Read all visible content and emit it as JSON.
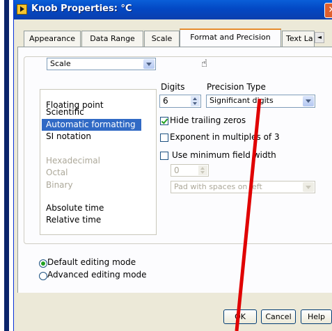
{
  "window": {
    "title": "Knob Properties: °C"
  },
  "tabs": [
    {
      "label": "Appearance"
    },
    {
      "label": "Data Range"
    },
    {
      "label": "Scale"
    },
    {
      "label": "Format and Precision",
      "active": true
    },
    {
      "label": "Text La"
    }
  ],
  "format": {
    "item_combo": {
      "value": "Scale"
    },
    "type_list": {
      "items": [
        {
          "label": "Floating point",
          "state": "normal"
        },
        {
          "label": "Scientific",
          "state": "normal"
        },
        {
          "label": "Automatic formatting",
          "state": "selected"
        },
        {
          "label": "SI notation",
          "state": "normal"
        },
        {
          "label": "Hexadecimal",
          "state": "disabled"
        },
        {
          "label": "Octal",
          "state": "disabled"
        },
        {
          "label": "Binary",
          "state": "disabled"
        },
        {
          "label": "Absolute time",
          "state": "normal"
        },
        {
          "label": "Relative time",
          "state": "normal"
        }
      ]
    },
    "digits": {
      "label": "Digits",
      "value": "6"
    },
    "precision_type": {
      "label": "Precision Type",
      "value": "Significant digits"
    },
    "hide_trailing": {
      "label": "Hide trailing zeros",
      "checked": true
    },
    "exponent_multiples": {
      "label": "Exponent in multiples of 3",
      "checked": false
    },
    "min_field_width": {
      "label": "Use minimum field width",
      "checked": false,
      "width_value": "0",
      "pad_value": "Pad with spaces on left"
    },
    "editing_mode": [
      {
        "label": "Default editing mode",
        "checked": true
      },
      {
        "label": "Advanced editing mode",
        "checked": false
      }
    ]
  },
  "buttons": {
    "ok": "OK",
    "cancel": "Cancel",
    "help": "Help"
  },
  "colors": {
    "title_bar": "#0348c4",
    "selection": "#316ac5",
    "annotation": "#e00000",
    "active_tab_border": "#e68b2c"
  }
}
